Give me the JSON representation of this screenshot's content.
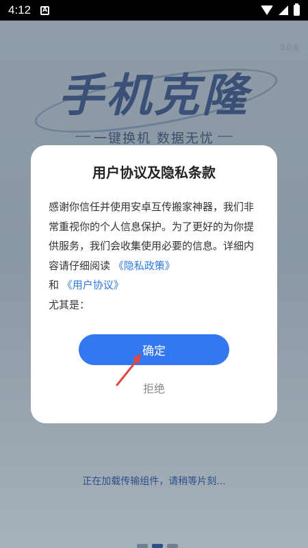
{
  "status_bar": {
    "time": "4:12",
    "notif_icon": "a-notification-icon"
  },
  "background": {
    "version": "3.0.6",
    "brand": "手机克隆",
    "slogan": "一键换机 数据无忧",
    "loading_text": "正在加载传输组件，请稍等片刻..."
  },
  "dialog": {
    "title": "用户协议及隐私条款",
    "body_intro": "感谢你信任并使用安卓互传搬家神器，我们非常重视你的个人信息保护。为了更好的为你提供服务，我们会收集使用必要的信息。详细内容请仔细阅读 ",
    "privacy_link": "《隐私政策》",
    "and": "和 ",
    "agreement_link": "《用户协议》",
    "especially": "尤其是：",
    "confirm_label": "确定",
    "reject_label": "拒绝"
  },
  "colors": {
    "primary": "#3478f0",
    "link": "#2f7ae5",
    "arrow": "#e2483d"
  }
}
